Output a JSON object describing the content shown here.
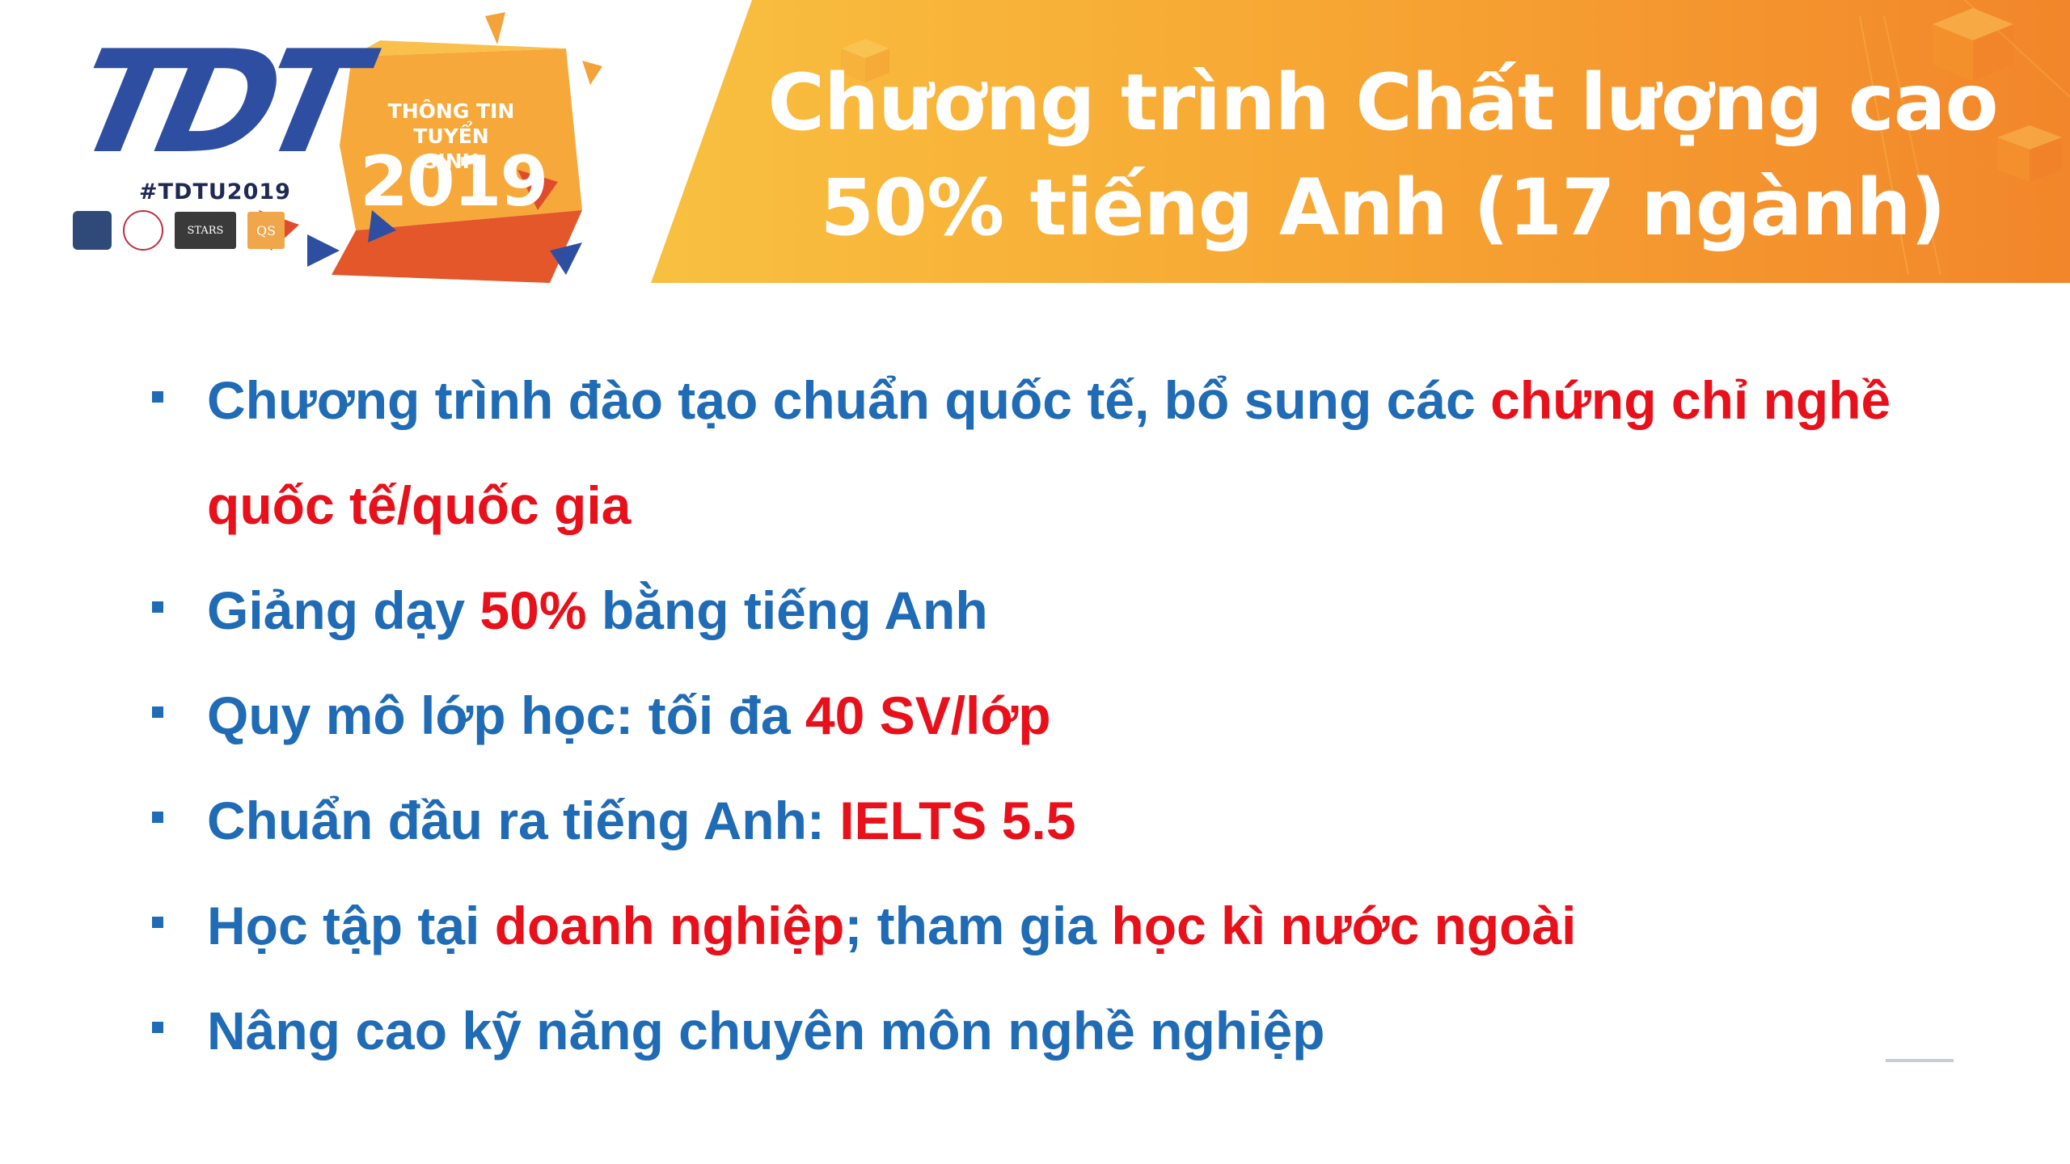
{
  "colors": {
    "header_orange_light": "#f7b23b",
    "header_orange_dark": "#f28a26",
    "bullet_blue": "#1f6bb5",
    "highlight_red": "#e8101a",
    "logo_blue": "#2e4fa1",
    "logo_red": "#e04b2b"
  },
  "header": {
    "title_line1": "Chương trình Chất lượng cao",
    "title_line2": "50% tiếng Anh (17 ngành)"
  },
  "logo": {
    "wordmark": "TDT",
    "hashtag": "#TDTU2019",
    "tagline_line1": "THÔNG TIN",
    "tagline_line2": "TUYỂN SINH",
    "year": "2019",
    "badges": [
      "",
      "",
      "STARS",
      "QS"
    ]
  },
  "bullets": [
    {
      "parts": [
        {
          "text": "Chương trình đào tạo chuẩn quốc tế, bổ sung các ",
          "hl": false
        },
        {
          "text": "chứng chỉ nghề quốc tế/quốc gia",
          "hl": true
        }
      ]
    },
    {
      "parts": [
        {
          "text": "Giảng dạy ",
          "hl": false
        },
        {
          "text": "50%",
          "hl": true
        },
        {
          "text": " bằng tiếng Anh",
          "hl": false
        }
      ]
    },
    {
      "parts": [
        {
          "text": "Quy mô lớp học: tối đa ",
          "hl": false
        },
        {
          "text": "40 SV/lớp",
          "hl": true
        }
      ]
    },
    {
      "parts": [
        {
          "text": "Chuẩn đầu ra tiếng Anh: ",
          "hl": false
        },
        {
          "text": "IELTS 5.5",
          "hl": true
        }
      ]
    },
    {
      "parts": [
        {
          "text": "Học tập tại ",
          "hl": false
        },
        {
          "text": "doanh nghiệp",
          "hl": true
        },
        {
          "text": "; tham gia ",
          "hl": false
        },
        {
          "text": "học kì nước ngoài",
          "hl": true
        }
      ]
    },
    {
      "parts": [
        {
          "text": "Nâng cao kỹ năng chuyên môn nghề nghiệp",
          "hl": false
        }
      ]
    }
  ]
}
